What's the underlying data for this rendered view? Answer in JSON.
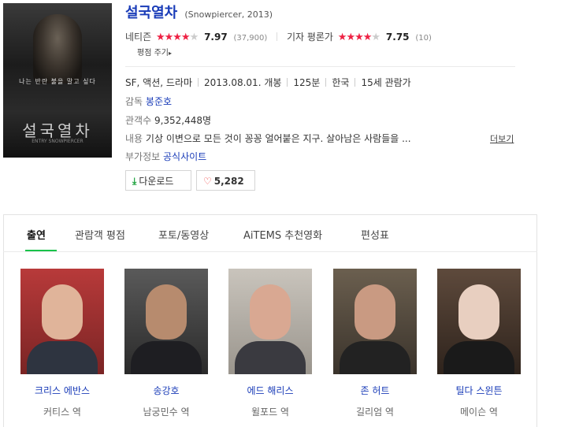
{
  "movie": {
    "title": "설국열차",
    "subtitle": "(Snowpiercer, 2013)",
    "poster": {
      "tagline": "나는 반란 불을 말고 싶다",
      "title": "설국열차",
      "credit": "ENTRY SNOWPIERCER"
    }
  },
  "ratings": {
    "netizen": {
      "label": "네티즌",
      "stars": 4,
      "score": "7.97",
      "count": "(37,900)"
    },
    "critic": {
      "label": "기자 평론가",
      "stars": 4,
      "score": "7.75",
      "count": "(10)"
    },
    "rate_link": "평점 주기"
  },
  "info": {
    "genre": "SF, 액션, 드라마",
    "release": "2013.08.01. 개봉",
    "runtime": "125분",
    "country": "한국",
    "age": "15세 관람가",
    "director_key": "감독",
    "director": "봉준호",
    "audience_key": "관객수",
    "audience": "9,352,448명",
    "synopsis_key": "내용",
    "synopsis": "기상 이변으로 모든 것이 꽁꽁 얼어붙은 지구. 살아남은 사람들을 ...",
    "more": "더보기",
    "extra_key": "부가정보",
    "extra": "공식사이트"
  },
  "buttons": {
    "download": "다운로드",
    "like_count": "5,282"
  },
  "tabs": [
    "출연",
    "관람객 평점",
    "포토/동영상",
    "AiTEMS 추천영화",
    "편성표"
  ],
  "cast": [
    {
      "name": "크리스 에반스",
      "role": "커티스 역"
    },
    {
      "name": "송강호",
      "role": "남궁민수 역"
    },
    {
      "name": "에드 해리스",
      "role": "윌포드 역"
    },
    {
      "name": "존 허트",
      "role": "길리엄 역"
    },
    {
      "name": "틸다 스윈튼",
      "role": "메이슨 역"
    }
  ],
  "colors": {
    "link": "#1a3cb8",
    "star": "#ee2244",
    "tab_accent": "#19c34a"
  }
}
